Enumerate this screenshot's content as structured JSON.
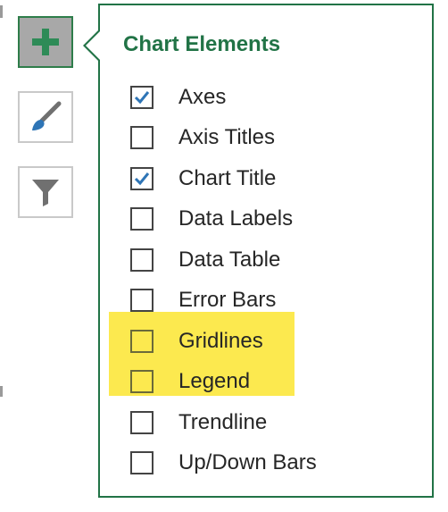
{
  "side_buttons": [
    {
      "name": "add-chart-element-button",
      "icon": "plus-icon",
      "active": true
    },
    {
      "name": "chart-styles-button",
      "icon": "paintbrush-icon",
      "active": false
    },
    {
      "name": "chart-filters-button",
      "icon": "funnel-icon",
      "active": false
    }
  ],
  "panel": {
    "title": "Chart Elements",
    "items": [
      {
        "label": "Axes",
        "checked": true
      },
      {
        "label": "Axis Titles",
        "checked": false
      },
      {
        "label": "Chart Title",
        "checked": true
      },
      {
        "label": "Data Labels",
        "checked": false
      },
      {
        "label": "Data Table",
        "checked": false
      },
      {
        "label": "Error Bars",
        "checked": false
      },
      {
        "label": "Gridlines",
        "checked": false,
        "highlighted": true
      },
      {
        "label": "Legend",
        "checked": false,
        "highlighted": true
      },
      {
        "label": "Trendline",
        "checked": false
      },
      {
        "label": "Up/Down Bars",
        "checked": false
      }
    ]
  },
  "colors": {
    "accent_green": "#217346",
    "check_blue": "#2e75b6",
    "highlight_yellow": "#fce94f",
    "active_button_gray": "#a8a8a8"
  }
}
